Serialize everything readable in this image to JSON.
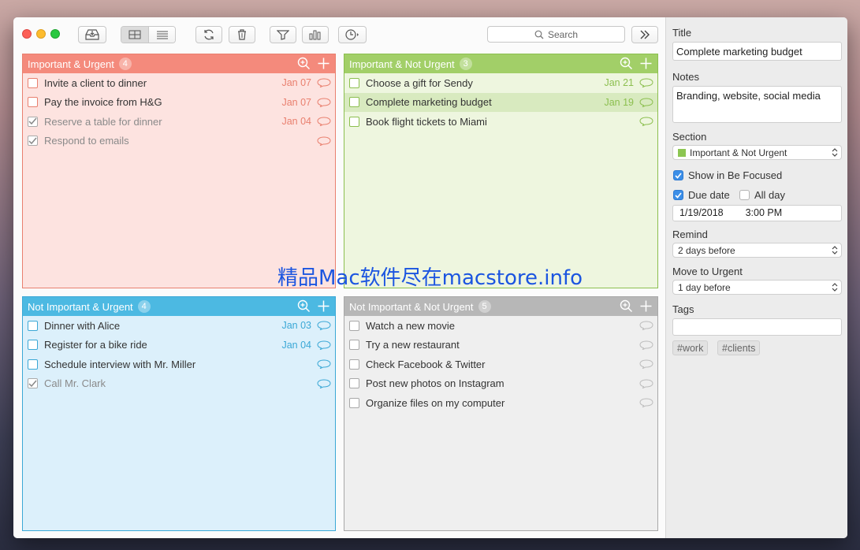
{
  "toolbar": {
    "buttons": [
      "inbox-icon",
      "grid-view-icon",
      "list-view-icon",
      "sync-icon",
      "trash-icon",
      "filter-icon",
      "stats-icon",
      "timer-icon"
    ],
    "search_placeholder": "Search",
    "collapse_icon": "double-chevron-right-icon"
  },
  "quadrants": [
    {
      "title": "Important & Urgent",
      "count": "4",
      "head_color": "#f48a7c",
      "body_color": "#fde3e0",
      "accent": "#e9806f",
      "tasks": [
        {
          "name": "Invite a client to dinner",
          "date": "Jan 07",
          "done": false
        },
        {
          "name": "Pay the invoice from H&G",
          "date": "Jan 07",
          "done": false
        },
        {
          "name": "Reserve a table for dinner",
          "date": "Jan 04",
          "done": true
        },
        {
          "name": "Respond to emails",
          "date": "",
          "done": true
        }
      ]
    },
    {
      "title": "Important & Not Urgent",
      "count": "3",
      "head_color": "#a2cf68",
      "body_color": "#eef6df",
      "accent": "#8cbf4f",
      "tasks": [
        {
          "name": "Choose a gift for Sendy",
          "date": "Jan 21",
          "done": false
        },
        {
          "name": "Complete marketing budget",
          "date": "Jan 19",
          "done": false
        },
        {
          "name": "Book flight tickets to Miami",
          "date": "",
          "done": false
        }
      ]
    },
    {
      "title": "Not Important & Urgent",
      "count": "4",
      "head_color": "#4cb9e2",
      "body_color": "#dcf0fb",
      "accent": "#3ba8d6",
      "tasks": [
        {
          "name": "Dinner with Alice",
          "date": "Jan 03",
          "done": false
        },
        {
          "name": "Register for a bike ride",
          "date": "Jan 04",
          "done": false
        },
        {
          "name": "Schedule interview with Mr. Miller",
          "date": "",
          "done": false
        },
        {
          "name": "Call Mr. Clark",
          "date": "",
          "done": true
        }
      ]
    },
    {
      "title": "Not Important & Not Urgent",
      "count": "5",
      "head_color": "#b7b7b7",
      "body_color": "#efefef",
      "accent": "#a8a8a8",
      "tasks": [
        {
          "name": "Watch a new movie",
          "date": "",
          "done": false
        },
        {
          "name": "Try a new restaurant",
          "date": "",
          "done": false
        },
        {
          "name": "Check Facebook & Twitter",
          "date": "",
          "done": false
        },
        {
          "name": "Post new photos on Instagram",
          "date": "",
          "done": false
        },
        {
          "name": "Organize files on my computer",
          "date": "",
          "done": false
        }
      ]
    }
  ],
  "inspector": {
    "title_label": "Title",
    "title_value": "Complete marketing budget",
    "notes_label": "Notes",
    "notes_value": "Branding, website, social media",
    "section_label": "Section",
    "section_value": "Important & Not Urgent",
    "section_color": "#8cc652",
    "show_focused_label": "Show in Be Focused",
    "due_date_label": "Due date",
    "all_day_label": "All day",
    "date_value": "1/19/2018",
    "time_value": "3:00 PM",
    "remind_label": "Remind",
    "remind_value": "2 days before",
    "move_label": "Move to Urgent",
    "move_value": "1 day before",
    "tags_label": "Tags",
    "tags": [
      "#work",
      "#clients"
    ]
  },
  "watermark": "精品Mac软件尽在macstore.info"
}
